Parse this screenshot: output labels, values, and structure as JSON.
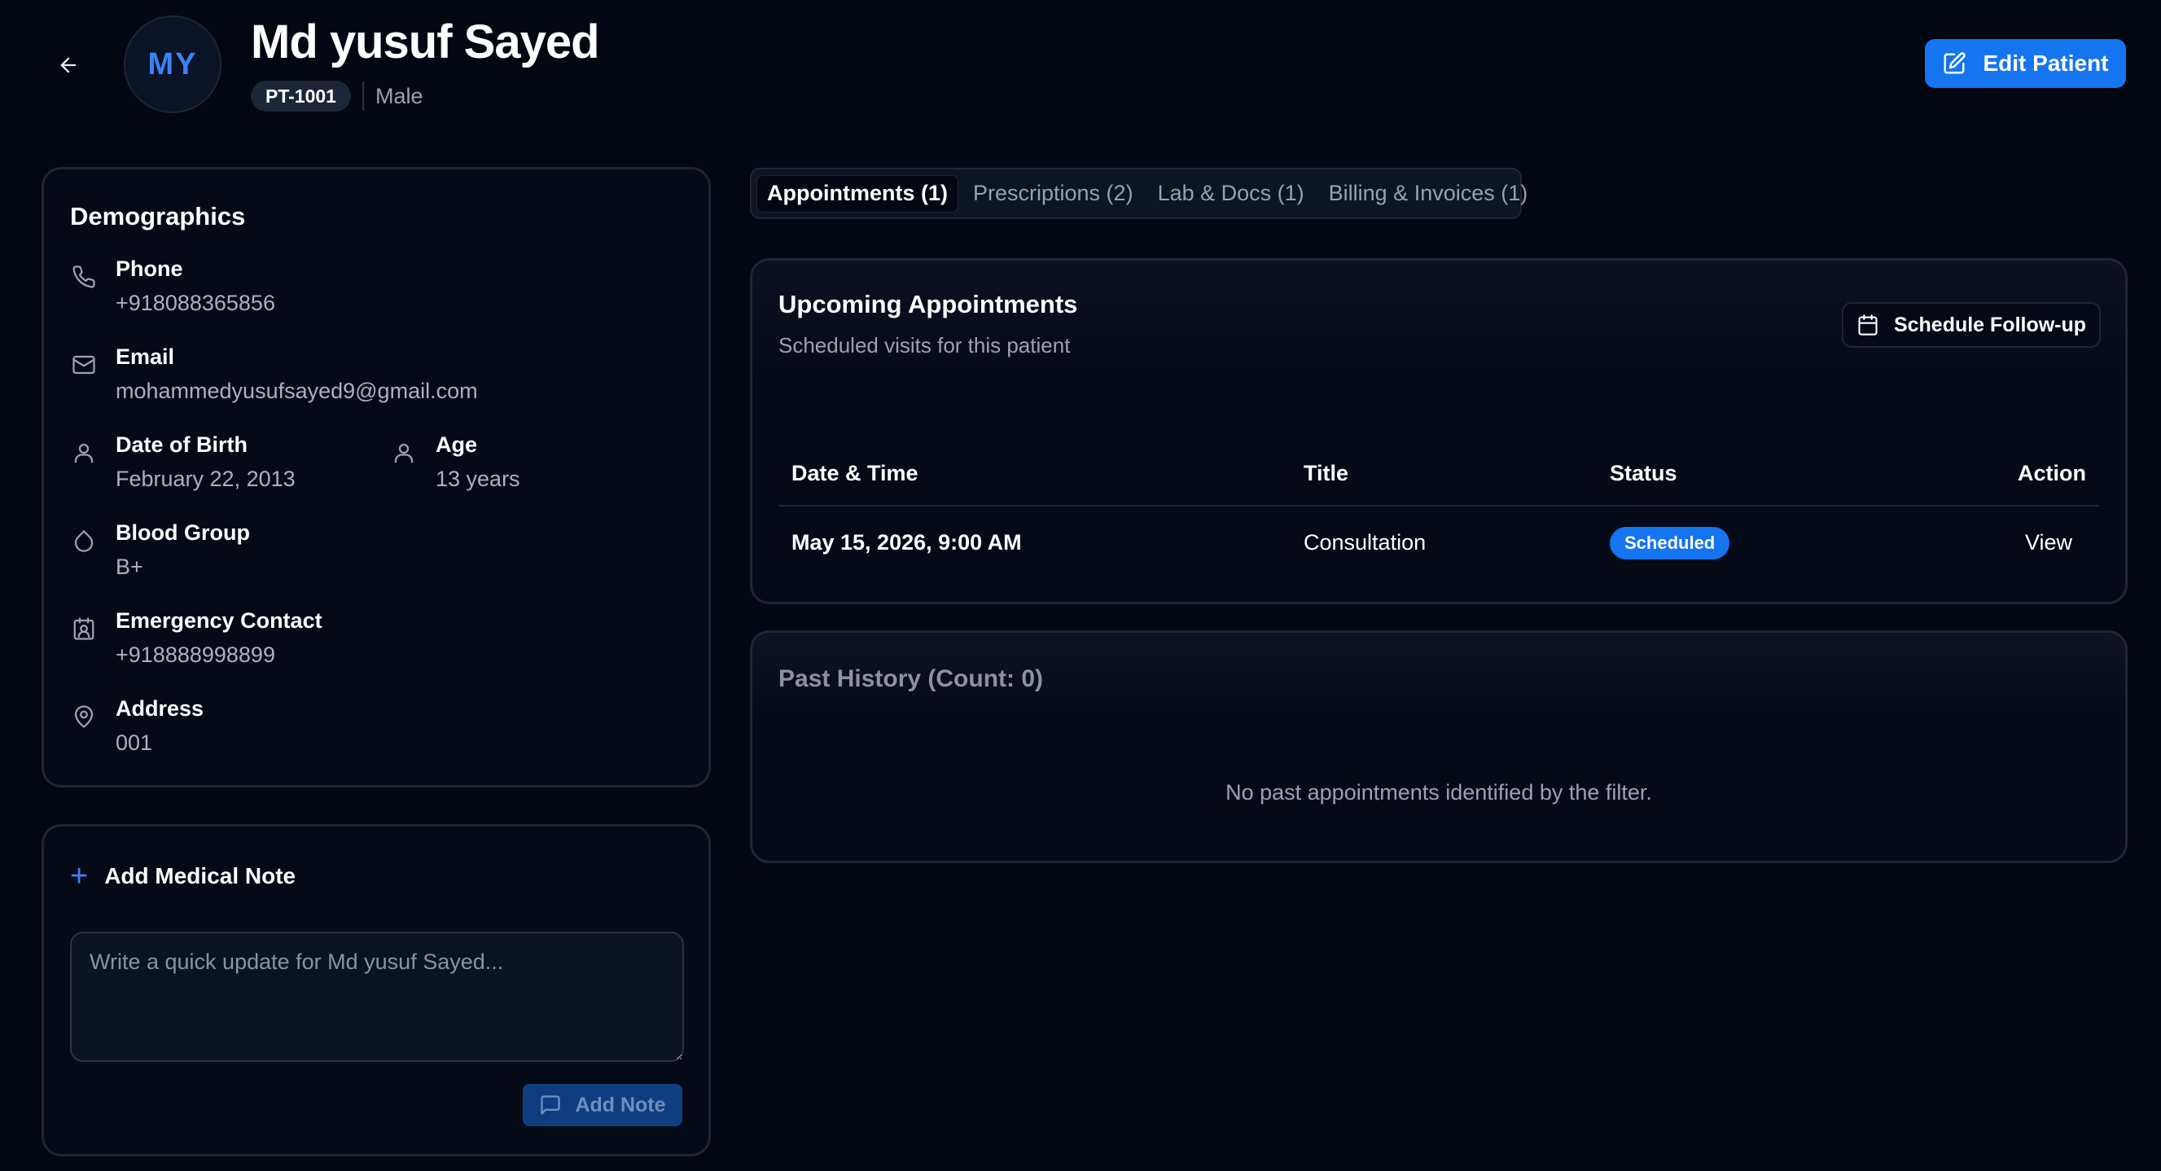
{
  "header": {
    "avatar_initials": "MY",
    "patient_name": "Md yusuf Sayed",
    "patient_id": "PT-1001",
    "gender": "Male",
    "edit_label": "Edit Patient"
  },
  "demographics": {
    "title": "Demographics",
    "phone": {
      "label": "Phone",
      "value": "+918088365856"
    },
    "email": {
      "label": "Email",
      "value": "mohammedyusufsayed9@gmail.com"
    },
    "dob": {
      "label": "Date of Birth",
      "value": "February 22, 2013"
    },
    "age": {
      "label": "Age",
      "value": "13 years"
    },
    "blood_group": {
      "label": "Blood Group",
      "value": "B+"
    },
    "emergency_contact": {
      "label": "Emergency Contact",
      "value": "+918888998899"
    },
    "address": {
      "label": "Address",
      "value": "001"
    }
  },
  "medical_note": {
    "title": "Add Medical Note",
    "placeholder": "Write a quick update for Md yusuf Sayed...",
    "button_label": "Add Note"
  },
  "tabs": [
    {
      "label": "Appointments (1)",
      "active": true
    },
    {
      "label": "Prescriptions (2)",
      "active": false
    },
    {
      "label": "Lab & Docs (1)",
      "active": false
    },
    {
      "label": "Billing & Invoices (1)",
      "active": false
    }
  ],
  "upcoming": {
    "title": "Upcoming Appointments",
    "subtitle": "Scheduled visits for this patient",
    "schedule_button": "Schedule Follow-up",
    "columns": [
      "Date & Time",
      "Title",
      "Status",
      "Action"
    ],
    "rows": [
      {
        "datetime": "May 15, 2026, 9:00 AM",
        "title": "Consultation",
        "status": "Scheduled",
        "action": "View"
      }
    ]
  },
  "past": {
    "title": "Past History (Count: 0)",
    "empty_message": "No past appointments identified by the filter."
  },
  "colors": {
    "background": "#030712",
    "accent": "#1574f0",
    "border": "#1e2636",
    "muted_text": "#9aa3b2"
  }
}
